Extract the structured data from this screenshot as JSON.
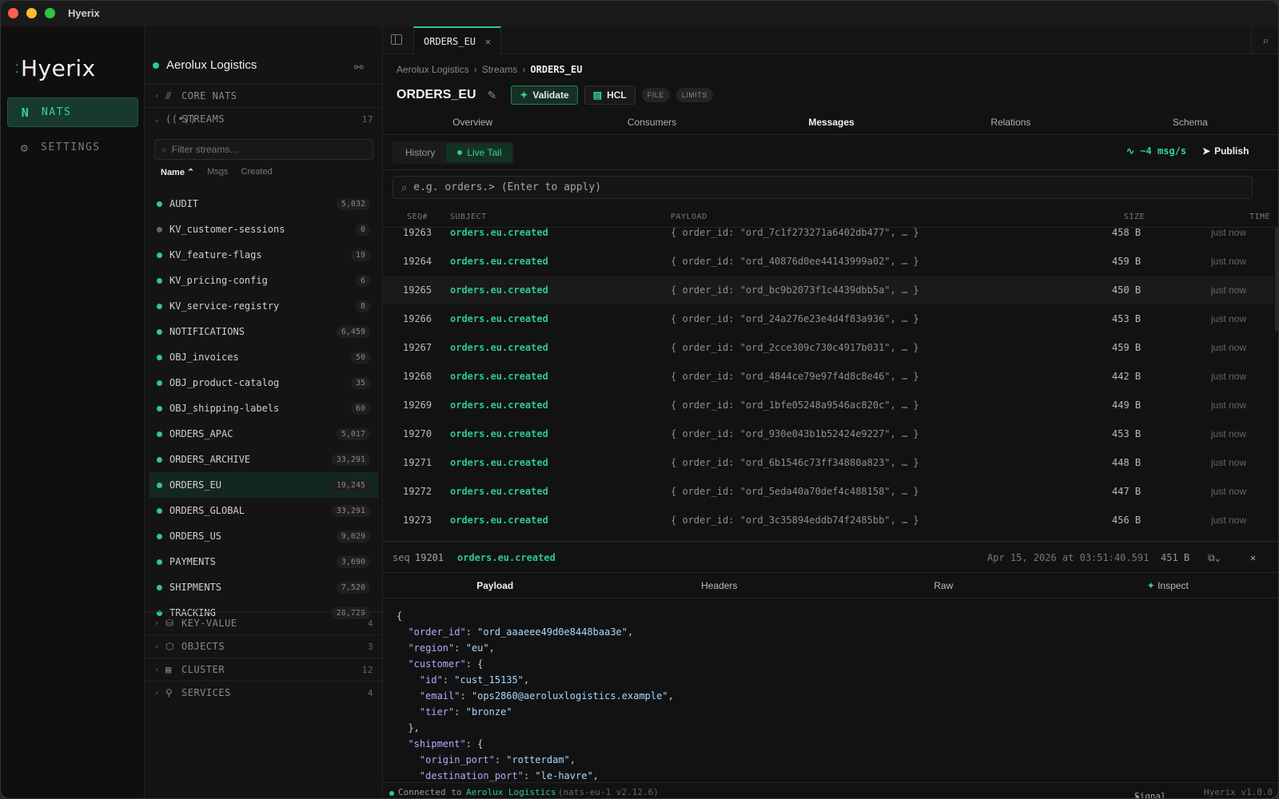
{
  "app": {
    "title": "Hyerix",
    "logo": "Hyerix"
  },
  "nav": {
    "nats": "NATS",
    "settings": "SETTINGS"
  },
  "sidebar": {
    "connection": "Aerolux Logistics",
    "core_nats": "CORE NATS",
    "streams": {
      "label": "STREAMS",
      "count": "17"
    },
    "filter_placeholder": "Filter streams...",
    "sort": {
      "name": "Name",
      "msgs": "Msgs",
      "created": "Created"
    },
    "items": [
      {
        "name": "AUDIT",
        "count": "5,032",
        "status": "active"
      },
      {
        "name": "KV_customer-sessions",
        "count": "0",
        "status": "idle"
      },
      {
        "name": "KV_feature-flags",
        "count": "19",
        "status": "active"
      },
      {
        "name": "KV_pricing-config",
        "count": "6",
        "status": "active"
      },
      {
        "name": "KV_service-registry",
        "count": "8",
        "status": "active"
      },
      {
        "name": "NOTIFICATIONS",
        "count": "6,459",
        "status": "active"
      },
      {
        "name": "OBJ_invoices",
        "count": "50",
        "status": "active"
      },
      {
        "name": "OBJ_product-catalog",
        "count": "35",
        "status": "active"
      },
      {
        "name": "OBJ_shipping-labels",
        "count": "60",
        "status": "active"
      },
      {
        "name": "ORDERS_APAC",
        "count": "5,017",
        "status": "active"
      },
      {
        "name": "ORDERS_ARCHIVE",
        "count": "33,291",
        "status": "active"
      },
      {
        "name": "ORDERS_EU",
        "count": "19,245",
        "status": "active",
        "selected": true
      },
      {
        "name": "ORDERS_GLOBAL",
        "count": "33,291",
        "status": "active"
      },
      {
        "name": "ORDERS_US",
        "count": "9,029",
        "status": "active"
      },
      {
        "name": "PAYMENTS",
        "count": "3,690",
        "status": "active"
      },
      {
        "name": "SHIPMENTS",
        "count": "7,520",
        "status": "active"
      },
      {
        "name": "TRACKING",
        "count": "20,729",
        "status": "active"
      }
    ],
    "groups": [
      {
        "label": "KEY-VALUE",
        "count": "4"
      },
      {
        "label": "OBJECTS",
        "count": "3"
      },
      {
        "label": "CLUSTER",
        "count": "12"
      },
      {
        "label": "SERVICES",
        "count": "4"
      }
    ]
  },
  "main": {
    "tab": "ORDERS_EU",
    "breadcrumb": [
      "Aerolux Logistics",
      "Streams",
      "ORDERS_EU"
    ],
    "title": "ORDERS_EU",
    "validate": "Validate",
    "hcl": "HCL",
    "pills": [
      "FILE",
      "LIMITS"
    ],
    "sections": [
      "Overview",
      "Consumers",
      "Messages",
      "Relations",
      "Schema"
    ],
    "modes": {
      "history": "History",
      "live": "Live Tail"
    },
    "rate": "~4 msg/s",
    "publish": "Publish",
    "subject_placeholder": "e.g. orders.> (Enter to apply)",
    "columns": {
      "seq": "SEQ#",
      "subject": "SUBJECT",
      "payload": "PAYLOAD",
      "size": "SIZE",
      "time": "TIME"
    },
    "messages": [
      {
        "seq": "19263",
        "subject": "orders.eu.created",
        "payload": "{ order_id: \"ord_7c1f273271a6402db477\", … }",
        "size": "458 B",
        "time": "just now"
      },
      {
        "seq": "19264",
        "subject": "orders.eu.created",
        "payload": "{ order_id: \"ord_40876d0ee44143999a02\", … }",
        "size": "459 B",
        "time": "just now"
      },
      {
        "seq": "19265",
        "subject": "orders.eu.created",
        "payload": "{ order_id: \"ord_bc9b2073f1c4439dbb5a\", … }",
        "size": "450 B",
        "time": "just now"
      },
      {
        "seq": "19266",
        "subject": "orders.eu.created",
        "payload": "{ order_id: \"ord_24a276e23e4d4f83a936\", … }",
        "size": "453 B",
        "time": "just now"
      },
      {
        "seq": "19267",
        "subject": "orders.eu.created",
        "payload": "{ order_id: \"ord_2cce309c730c4917b031\", … }",
        "size": "459 B",
        "time": "just now"
      },
      {
        "seq": "19268",
        "subject": "orders.eu.created",
        "payload": "{ order_id: \"ord_4844ce79e97f4d8c8e46\", … }",
        "size": "442 B",
        "time": "just now"
      },
      {
        "seq": "19269",
        "subject": "orders.eu.created",
        "payload": "{ order_id: \"ord_1bfe05248a9546ac820c\", … }",
        "size": "449 B",
        "time": "just now"
      },
      {
        "seq": "19270",
        "subject": "orders.eu.created",
        "payload": "{ order_id: \"ord_930e043b1b52424e9227\", … }",
        "size": "453 B",
        "time": "just now"
      },
      {
        "seq": "19271",
        "subject": "orders.eu.created",
        "payload": "{ order_id: \"ord_6b1546c73ff34880a823\", … }",
        "size": "448 B",
        "time": "just now"
      },
      {
        "seq": "19272",
        "subject": "orders.eu.created",
        "payload": "{ order_id: \"ord_5eda40a70def4c488158\", … }",
        "size": "447 B",
        "time": "just now"
      },
      {
        "seq": "19273",
        "subject": "orders.eu.created",
        "payload": "{ order_id: \"ord_3c35894eddb74f2485bb\", … }",
        "size": "456 B",
        "time": "just now"
      }
    ],
    "detail": {
      "seq_label": "seq",
      "seq": "19201",
      "subject": "orders.eu.created",
      "timestamp": "Apr 15, 2026 at 03:51:40.591",
      "size": "451 B",
      "tabs": [
        "Payload",
        "Headers",
        "Raw",
        "Inspect"
      ]
    },
    "payload": {
      "order_id": "ord_aaaeee49d0e8448baa3e",
      "region": "eu",
      "customer": {
        "id": "cust_15135",
        "email": "ops2860@aeroluxlogistics.example",
        "tier": "bronze"
      },
      "shipment": {
        "origin_port": "rotterdam",
        "destination_port": "le-havre"
      }
    }
  },
  "status": {
    "connected_prefix": "Connected to",
    "connection": "Aerolux Logistics",
    "server": "(nats-eu-1 v2.12.6)",
    "signal": "Signal",
    "version": "Hyerix v1.0.0"
  },
  "colors": {
    "accent": "#2dc98d",
    "background": "#121212"
  }
}
